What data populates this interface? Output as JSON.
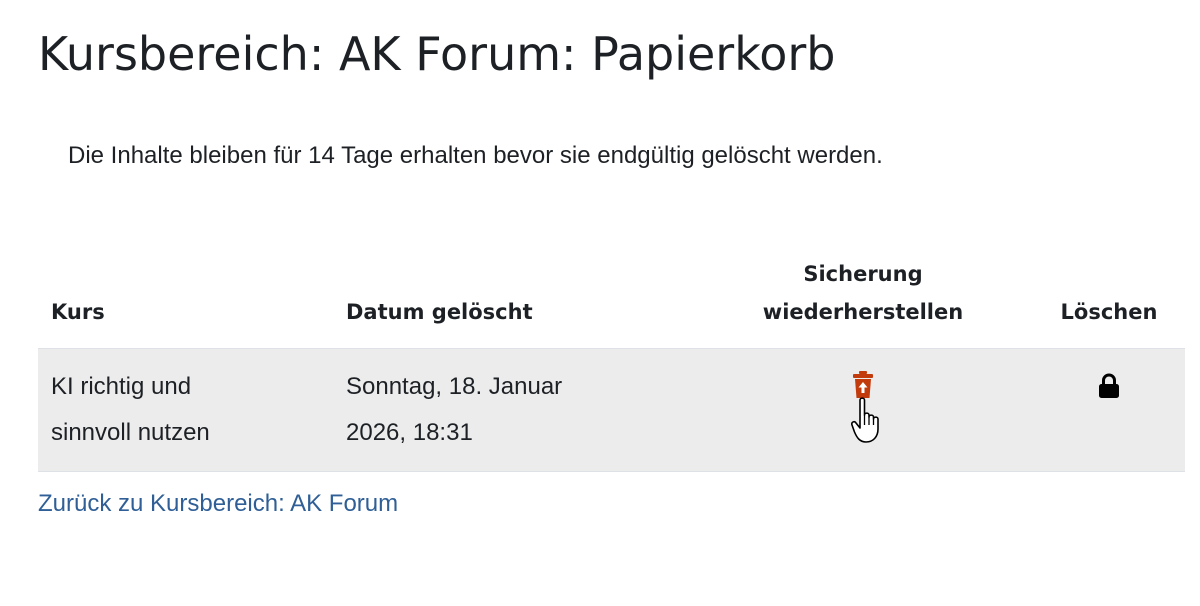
{
  "page": {
    "title": "Kursbereich: AK Forum: Papierkorb",
    "info": "Die Inhalte bleiben für 14 Tage erhalten bevor sie endgültig gelöscht werden."
  },
  "table": {
    "headers": {
      "course": "Kurs",
      "date_deleted": "Datum gelöscht",
      "restore_line1": "Sicherung",
      "restore_line2": "wiederherstellen",
      "delete": "Löschen"
    },
    "rows": [
      {
        "course_line1": "KI richtig und",
        "course_line2": "sinnvoll nutzen",
        "date_line1": "Sonntag, 18. Januar",
        "date_line2": "2026, 18:31",
        "restore_icon": "trash-restore-icon",
        "delete_icon": "lock-icon"
      }
    ]
  },
  "back_link": "Zurück zu Kursbereich: AK Forum",
  "colors": {
    "restore_icon": "#c23b0c",
    "link": "#2f5f96",
    "row_background": "#ececec"
  }
}
